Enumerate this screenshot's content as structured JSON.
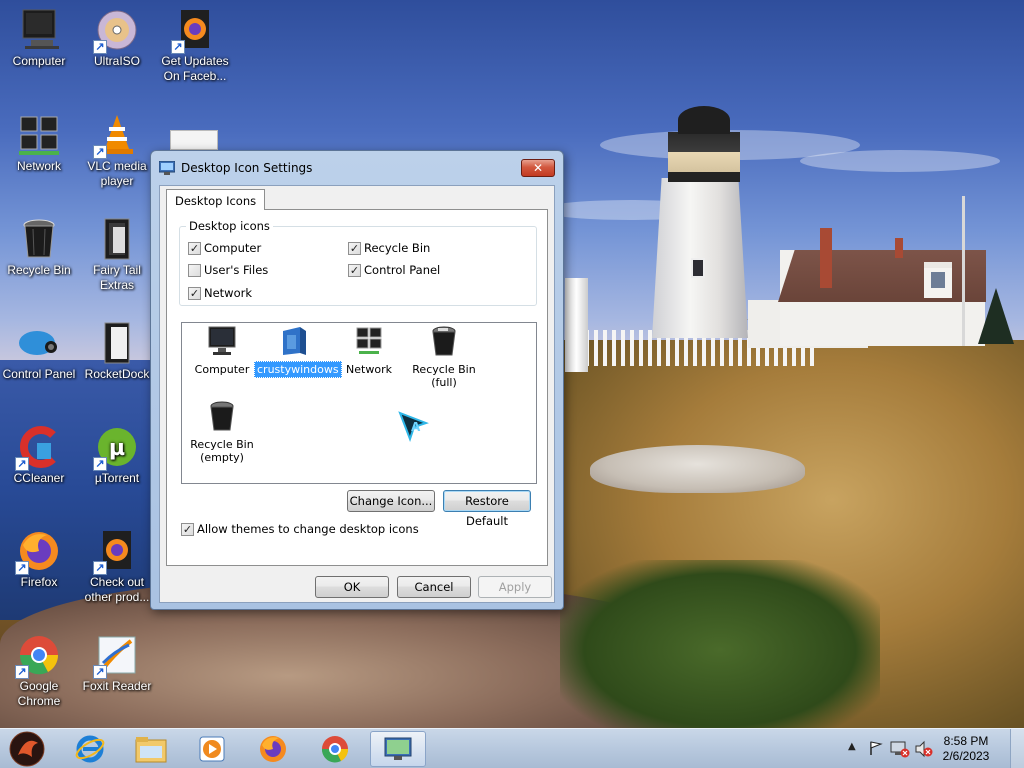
{
  "desktop": {
    "icons": [
      {
        "label": "Computer",
        "icon": "computer-icon"
      },
      {
        "label": "UltraISO",
        "icon": "disc-icon"
      },
      {
        "label": "Get Updates On Faceb...",
        "icon": "firefox-doc-icon"
      },
      {
        "label": "Network",
        "icon": "network-icon"
      },
      {
        "label": "VLC media player",
        "icon": "vlc-cone-icon"
      },
      {
        "label": "Recycle Bin",
        "icon": "recycle-bin-icon"
      },
      {
        "label": "Fairy Tail Extras",
        "icon": "folder-icon"
      },
      {
        "label": "Control Panel",
        "icon": "control-panel-icon"
      },
      {
        "label": "RocketDock",
        "icon": "folder-icon"
      },
      {
        "label": "CCleaner",
        "icon": "ccleaner-icon"
      },
      {
        "label": "µTorrent",
        "icon": "utorrent-icon"
      },
      {
        "label": "Firefox",
        "icon": "firefox-icon"
      },
      {
        "label": "Check out other prod...",
        "icon": "firefox-doc-icon"
      },
      {
        "label": "Google Chrome",
        "icon": "chrome-icon"
      },
      {
        "label": "Foxit Reader",
        "icon": "foxit-icon"
      }
    ]
  },
  "dialog": {
    "title": "Desktop Icon Settings",
    "close_label": "✕",
    "tab_label": "Desktop Icons",
    "group_label": "Desktop icons",
    "checkboxes": [
      {
        "label": "Computer",
        "checked": true
      },
      {
        "label": "Recycle Bin",
        "checked": true
      },
      {
        "label": "User's Files",
        "checked": false
      },
      {
        "label": "Control Panel",
        "checked": true
      },
      {
        "label": "Network",
        "checked": true
      }
    ],
    "icons": [
      {
        "label": "Computer",
        "icon": "monitor-icon",
        "selected": false
      },
      {
        "label": "crustywindows",
        "icon": "user-folder-icon",
        "selected": true
      },
      {
        "label": "Network",
        "icon": "network-icon",
        "selected": false
      },
      {
        "label": "Recycle Bin (full)",
        "icon": "recycle-bin-full-icon",
        "selected": false
      },
      {
        "label": "Recycle Bin (empty)",
        "icon": "recycle-bin-empty-icon",
        "selected": false
      }
    ],
    "change_icon_label": "Change Icon...",
    "restore_default_label": "Restore Default",
    "allow_themes_label": "Allow themes to change desktop icons",
    "allow_themes_checked": true,
    "ok_label": "OK",
    "cancel_label": "Cancel",
    "apply_label": "Apply"
  },
  "taskbar": {
    "items": [
      "start-orb-icon",
      "internet-explorer-icon",
      "file-explorer-icon",
      "media-player-icon",
      "firefox-icon",
      "chrome-icon",
      "desktop-icon-settings-icon"
    ],
    "time": "8:58 PM",
    "date": "2/6/2023"
  },
  "colors": {
    "selection": "#3399ff",
    "taskbar": "#b9cadf",
    "close_button": "#c23a22"
  }
}
